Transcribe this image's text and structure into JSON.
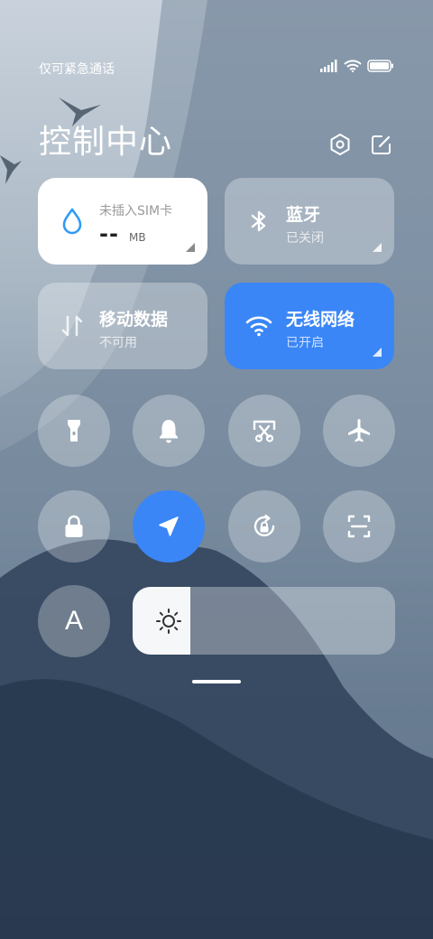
{
  "status_bar": {
    "carrier": "仅可紧急通话",
    "icons": [
      "signal-icon",
      "wifi-icon",
      "battery-icon"
    ]
  },
  "header": {
    "title": "控制中心",
    "settings_icon": "settings-icon",
    "edit_icon": "edit-icon"
  },
  "tiles": {
    "data_usage": {
      "label": "未插入SIM卡",
      "value": "--",
      "unit": "MB",
      "icon": "water-drop-icon"
    },
    "bluetooth": {
      "title": "蓝牙",
      "status": "已关闭",
      "icon": "bluetooth-icon"
    },
    "mobile_data": {
      "title": "移动数据",
      "status": "不可用",
      "icon": "mobile-data-icon"
    },
    "wifi": {
      "title": "无线网络",
      "status": "已开启",
      "icon": "wifi-icon"
    }
  },
  "toggles": [
    {
      "name": "flashlight",
      "icon": "flashlight-icon",
      "active": false
    },
    {
      "name": "ringer",
      "icon": "bell-icon",
      "active": false
    },
    {
      "name": "screenshot",
      "icon": "screenshot-icon",
      "active": false
    },
    {
      "name": "airplane-mode",
      "icon": "airplane-icon",
      "active": false
    },
    {
      "name": "lock-screen",
      "icon": "lock-icon",
      "active": false
    },
    {
      "name": "location",
      "icon": "location-arrow-icon",
      "active": true
    },
    {
      "name": "auto-rotate",
      "icon": "rotation-lock-icon",
      "active": false
    },
    {
      "name": "scanner",
      "icon": "scan-icon",
      "active": false
    },
    {
      "name": "font-size",
      "icon": "font-icon",
      "label": "A",
      "active": false
    }
  ],
  "brightness": {
    "icon": "brightness-icon",
    "level": 0.22
  },
  "colors": {
    "accent": "#3a86f6",
    "tile_light": "#ffffff",
    "sim_icon": "#2f9bf5"
  }
}
